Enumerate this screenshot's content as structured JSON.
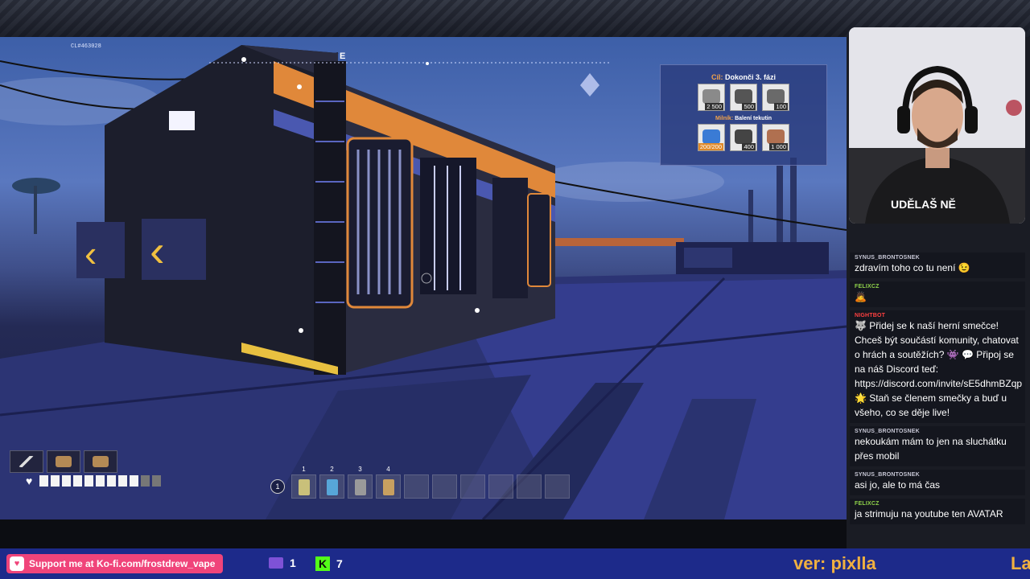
{
  "stream": {
    "build_id": "CL#463028",
    "compass_marker": "E"
  },
  "quest": {
    "goal_prefix": "Cíl:",
    "goal_text": "Dokonči 3. fázi",
    "goal_items": [
      {
        "icon": "frame-icon",
        "qty": "2 500",
        "color": "#8a8a8a"
      },
      {
        "icon": "modular-frame-icon",
        "qty": "500",
        "color": "#555"
      },
      {
        "icon": "rotor-icon",
        "qty": "100",
        "color": "#6a6a6a"
      }
    ],
    "milestone_prefix": "Milník:",
    "milestone_text": "Balení tekutin",
    "milestone_items": [
      {
        "icon": "clock-check-icon",
        "qty": "200/200",
        "color": "#3a7bd5",
        "done": true
      },
      {
        "icon": "steel-pipe-icon",
        "qty": "400",
        "color": "#444"
      },
      {
        "icon": "copper-icon",
        "qty": "1 000",
        "color": "#b07050"
      }
    ]
  },
  "hud": {
    "tools": [
      "pickaxe-icon",
      "scanner-icon",
      "hand-icon"
    ],
    "health_filled": 9,
    "health_total": 11,
    "hotbar_key": "1",
    "hotbar_slots": [
      {
        "num": "1",
        "item": "#c9c07a"
      },
      {
        "num": "2",
        "item": "#57a6d8"
      },
      {
        "num": "3",
        "item": "#9a9a9a"
      },
      {
        "num": "4",
        "item": "#c8a060"
      },
      {
        "num": "",
        "item": ""
      },
      {
        "num": "",
        "item": ""
      },
      {
        "num": "",
        "item": ""
      },
      {
        "num": "",
        "item": ""
      },
      {
        "num": "",
        "item": ""
      },
      {
        "num": "",
        "item": ""
      }
    ]
  },
  "chat": {
    "messages": [
      {
        "user": "SYNUS_BRONTOSNEK",
        "user_class": "",
        "text": "zdravím toho co tu není 😉"
      },
      {
        "user": "FELIXCZ",
        "user_class": "green",
        "text": "🙇"
      },
      {
        "user": "NIGHTBOT",
        "user_class": "red",
        "text": "🐺 Přidej se k naší herní smečce! Chceš být součástí komunity, chatovat o hrách a soutěžích? 👾 💬 Připoj se na náš Discord teď: https://discord.com/invite/sE5dhmBZqp 🌟 Staň se členem smečky a buď u všeho, co se děje live!"
      },
      {
        "user": "SYNUS_BRONTOSNEK",
        "user_class": "",
        "text": "nekoukám mám to jen na sluchátku přes mobil"
      },
      {
        "user": "SYNUS_BRONTOSNEK",
        "user_class": "",
        "text": "asi jo, ale to má čas"
      },
      {
        "user": "FELIXCZ",
        "user_class": "green",
        "text": "ja strimuju na youtube ten AVATAR"
      }
    ]
  },
  "bottom": {
    "kofi_text": "Support me at Ko-fi.com/frostdrew_vape",
    "twitch_count": "1",
    "kick_count": "7",
    "ticker_text": "ver: pixlla",
    "ticker_tail": "La"
  },
  "colors": {
    "kofi": "#f0447a",
    "bar": "#1d2a8a",
    "ticker": "#f0b040",
    "accent_orange": "#e08a2a"
  }
}
